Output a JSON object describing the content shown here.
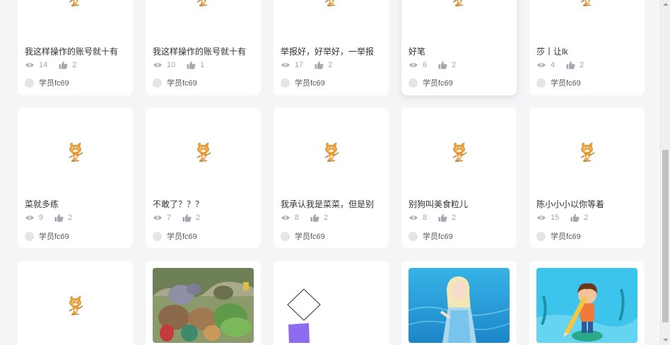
{
  "projects": [
    {
      "title": "我这样操作的账号就十有",
      "views": "14",
      "likes": "2",
      "author": "学员fc69",
      "thumb": "scratch-cat"
    },
    {
      "title": "我这样操作的账号就十有",
      "views": "10",
      "likes": "1",
      "author": "学员fc69",
      "thumb": "scratch-cat"
    },
    {
      "title": "举报好，好举好，一举报",
      "views": "17",
      "likes": "2",
      "author": "学员fc69",
      "thumb": "scratch-cat"
    },
    {
      "title": "好笔",
      "views": "6",
      "likes": "2",
      "author": "学员fc69",
      "thumb": "scratch-cat"
    },
    {
      "title": "莎丨让lk",
      "views": "4",
      "likes": "2",
      "author": "学员fc69",
      "thumb": "scratch-cat"
    },
    {
      "title": "菜就多练",
      "views": "9",
      "likes": "2",
      "author": "学员fc69",
      "thumb": "scratch-cat"
    },
    {
      "title": "不敢了？？？",
      "views": "7",
      "likes": "2",
      "author": "学员fc69",
      "thumb": "scratch-cat"
    },
    {
      "title": "我承认我是菜菜，但是别",
      "views": "8",
      "likes": "2",
      "author": "学员fc69",
      "thumb": "scratch-cat"
    },
    {
      "title": "别狗叫美食粒儿",
      "views": "8",
      "likes": "2",
      "author": "学员fc69",
      "thumb": "scratch-cat"
    },
    {
      "title": "陈小小小以你等着",
      "views": "15",
      "likes": "2",
      "author": "学员fc69",
      "thumb": "scratch-cat"
    },
    {
      "thumb": "scratch-cat"
    },
    {
      "thumb": "dinosaur-crowd-picture"
    },
    {
      "thumb": "diamond-square-drawing"
    },
    {
      "thumb": "ice-princess-picture"
    },
    {
      "thumb": "boy-with-pencil-picture"
    }
  ],
  "colors": {
    "background": "#f4f5f7",
    "card": "#ffffff",
    "meta": "#a3a8b0",
    "title": "#333333"
  }
}
